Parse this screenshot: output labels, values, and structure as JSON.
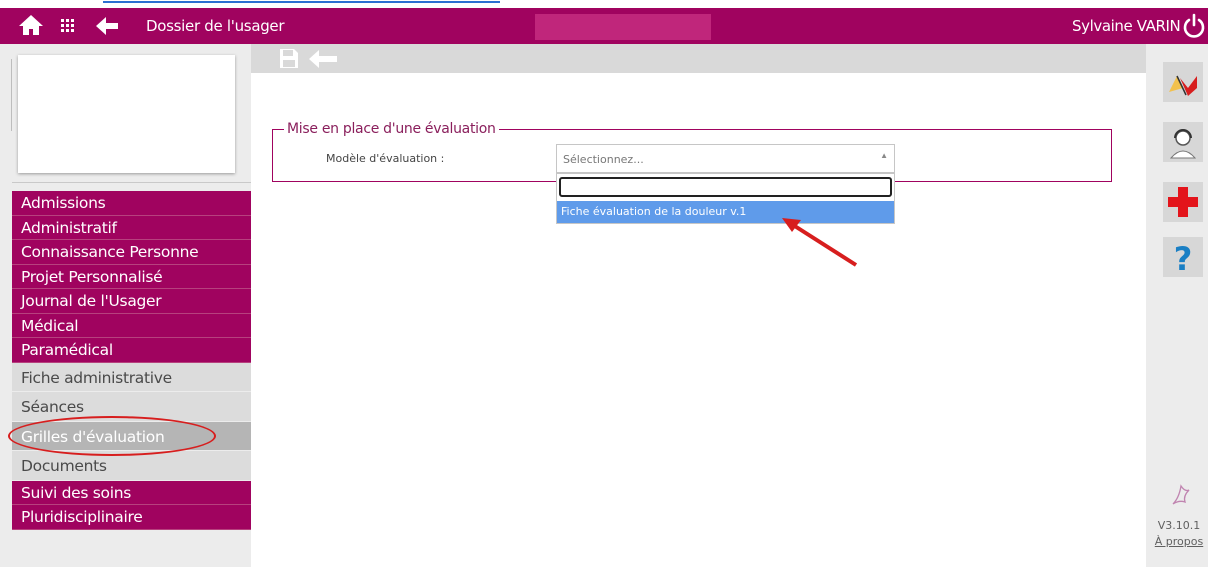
{
  "header": {
    "title": "Dossier de l'usager",
    "user_name": "Sylvaine VARIN",
    "brand_color": "#a0035f"
  },
  "sidebar": {
    "items": [
      {
        "label": "Admissions",
        "type": "main"
      },
      {
        "label": "Administratif",
        "type": "main"
      },
      {
        "label": "Connaissance Personne",
        "type": "main"
      },
      {
        "label": "Projet Personnalisé",
        "type": "main"
      },
      {
        "label": "Journal de l'Usager",
        "type": "main"
      },
      {
        "label": "Médical",
        "type": "main"
      },
      {
        "label": "Paramédical",
        "type": "main"
      },
      {
        "label": "Fiche administrative",
        "type": "sub"
      },
      {
        "label": "Séances",
        "type": "sub"
      },
      {
        "label": "Grilles d'évaluation",
        "type": "sub",
        "active": true
      },
      {
        "label": "Documents",
        "type": "sub"
      },
      {
        "label": "Suivi des soins",
        "type": "main"
      },
      {
        "label": "Pluridisciplinaire",
        "type": "main"
      }
    ]
  },
  "main": {
    "section_legend": "Mise en place d'une évaluation",
    "field_label": "Modèle d'évaluation :",
    "select_placeholder": "Sélectionnez...",
    "dropdown_search_value": "",
    "dropdown_options": [
      "Fiche évaluation de la douleur v.1"
    ]
  },
  "rightbar": {
    "icons": [
      "flags-icon",
      "support-agent-icon",
      "medical-cross-icon",
      "help-icon"
    ],
    "version": "V3.10.1",
    "about_link": "À propos"
  }
}
